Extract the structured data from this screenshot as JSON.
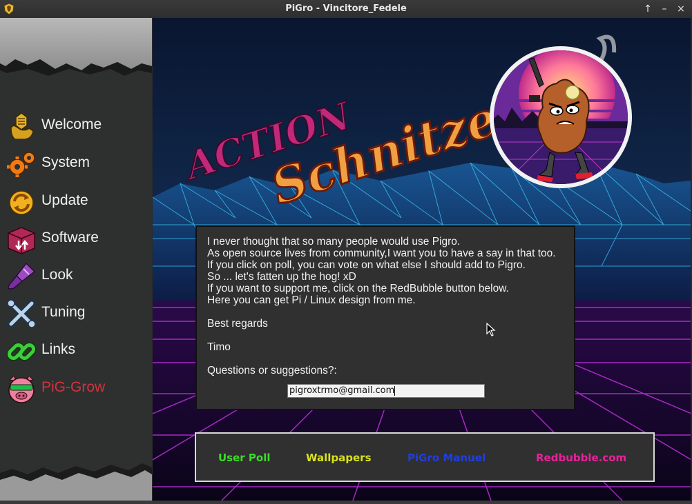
{
  "window": {
    "title": "PiGro - Vincitore_Fedele",
    "controls": [
      "↑",
      "–",
      "×"
    ]
  },
  "sidebar": {
    "items": [
      {
        "label": "Welcome",
        "icon": "honeycomb-hand-icon"
      },
      {
        "label": "System",
        "icon": "gears-icon"
      },
      {
        "label": "Update",
        "icon": "refresh-arrows-icon"
      },
      {
        "label": "Software",
        "icon": "package-box-icon"
      },
      {
        "label": "Look",
        "icon": "paint-brush-icon"
      },
      {
        "label": "Tuning",
        "icon": "crossed-tools-icon"
      },
      {
        "label": "Links",
        "icon": "chain-link-icon"
      },
      {
        "label": "PiG-Grow",
        "icon": "pig-with-sunglasses-icon",
        "active": true
      }
    ]
  },
  "banner": {
    "line1": "ACTION",
    "line2": "Schnitzel"
  },
  "message": {
    "lines": [
      "I never thought that so many people would use Pigro.",
      "As open source lives from community,I want you to have a say in that too.",
      "If you click on poll, you can vote on what else I should add to Pigro.",
      "So ... let's fatten up the hog! xD",
      "If you want to support me, click on the RedBubble button below.",
      "Here you can get Pi / Linux design from me.",
      "",
      "Best regards",
      "",
      "Timo",
      "",
      "Questions or suggestions?:"
    ],
    "email": "pigroxtrmo@gmail.com"
  },
  "links": [
    {
      "label": "User Poll",
      "color": "#3ddc2a"
    },
    {
      "label": "Wallpapers",
      "color": "#d9e21e"
    },
    {
      "label": "PiGro Manuel",
      "color": "#1f3fe0"
    },
    {
      "label": "Redbubble.com",
      "color": "#e8229a"
    }
  ]
}
